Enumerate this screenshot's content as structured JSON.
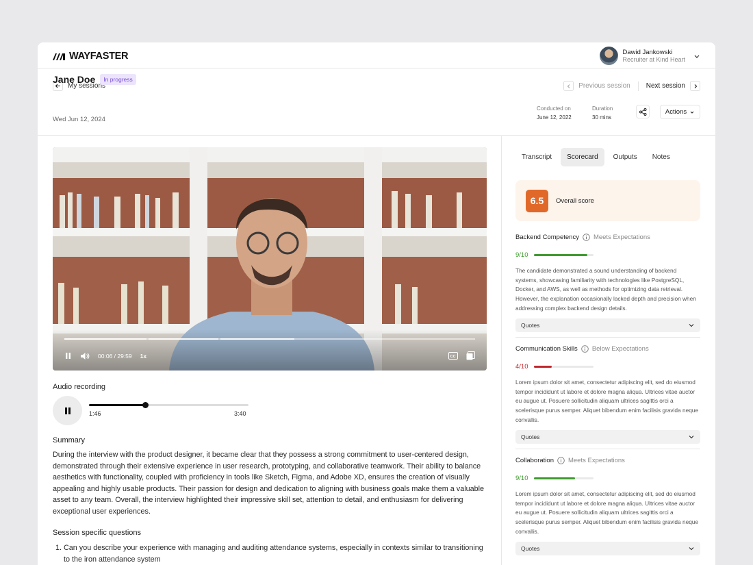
{
  "brand": {
    "name": "WAYFASTER"
  },
  "user": {
    "name": "Dawid Jankowski",
    "role": "Recruiter at Kind Heart"
  },
  "nav": {
    "back_label": "My sessions",
    "prev_label": "Previous session",
    "next_label": "Next session"
  },
  "session": {
    "candidate": "Jane Doe",
    "status": "In progress",
    "date": "Wed Jun 12, 2024",
    "conducted_label": "Conducted on",
    "conducted_value": "June 12, 2022",
    "duration_label": "Duration",
    "duration_value": "30 mins",
    "actions_label": "Actions"
  },
  "video": {
    "time": "00:06 / 29:59",
    "speed": "1x",
    "progress": 0.003
  },
  "audio": {
    "label": "Audio recording",
    "current": "1:46",
    "total": "3:40",
    "progress": 0.354
  },
  "summary": {
    "heading": "Summary",
    "text": "During the interview with the product designer, it became clear that they possess a strong commitment to user-centered design, demonstrated through their extensive experience in user research, prototyping, and collaborative teamwork. Their ability to balance aesthetics with functionality, coupled with proficiency in tools like Sketch, Figma, and Adobe XD, ensures the creation of visually appealing and highly usable products. Their passion for design and dedication to aligning with business goals make them a valuable asset to any team. Overall, the interview highlighted their impressive skill set, attention to detail, and enthusiasm for delivering exceptional user experiences."
  },
  "questions": {
    "heading": "Session specific questions",
    "items": [
      "Can you describe your experience with managing and auditing attendance systems, especially in contexts similar to transitioning to the iron attendance system"
    ]
  },
  "tabs": [
    "Transcript",
    "Scorecard",
    "Outputs",
    "Notes"
  ],
  "overall": {
    "score": "6.5",
    "label": "Overall score"
  },
  "competencies": [
    {
      "name": "Backend Competency",
      "status": "Meets Expectations",
      "score": "9/10",
      "value": 0.9,
      "color": "#3f9a2e",
      "text": "The candidate demonstrated a sound understanding of backend systems, showcasing familiarity with technologies like PostgreSQL, Docker, and AWS, as well as methods for optimizing data retrieval. However, the explanation occasionally lacked depth and precision when addressing complex backend design details.",
      "quotes_label": "Quotes"
    },
    {
      "name": "Communication Skills",
      "status": "Below Expectations",
      "score": "4/10",
      "value": 0.3,
      "color": "#c0262d",
      "text": "Lorem ipsum dolor sit amet, consectetur adipiscing elit, sed do eiusmod tempor incididunt ut labore et dolore magna aliqua. Ultrices vitae auctor eu augue ut. Posuere sollicitudin aliquam ultrices sagittis orci a scelerisque purus semper. Aliquet bibendum enim facilisis gravida neque convallis.",
      "quotes_label": "Quotes"
    },
    {
      "name": "Collaboration",
      "status": "Meets Expectations",
      "score": "9/10",
      "value": 0.7,
      "color": "#3f9a2e",
      "text": "Lorem ipsum dolor sit amet, consectetur adipiscing elit, sed do eiusmod tempor incididunt ut labore et dolore magna aliqua. Ultrices vitae auctor eu augue ut. Posuere sollicitudin aliquam ultrices sagittis orci a scelerisque purus semper. Aliquet bibendum enim facilisis gravida neque convallis.",
      "quotes_label": "Quotes"
    }
  ]
}
